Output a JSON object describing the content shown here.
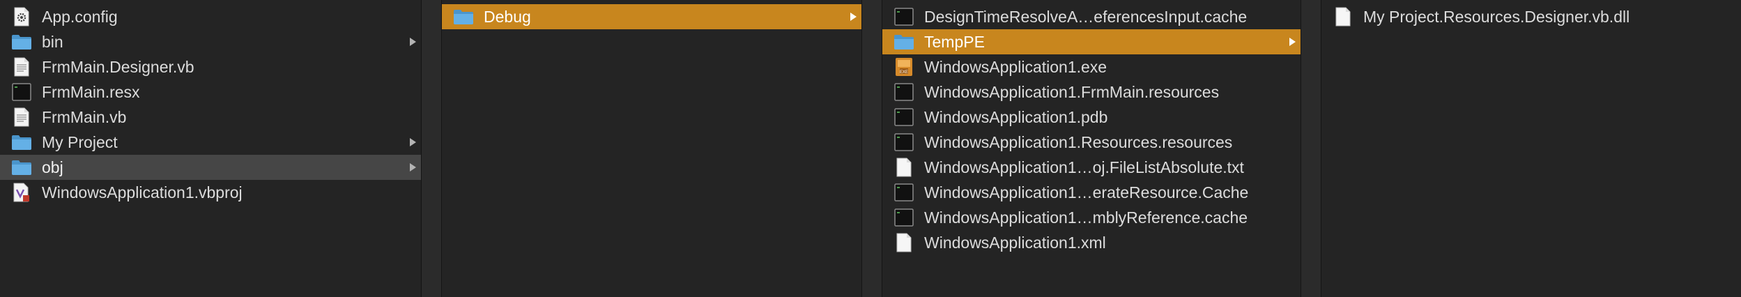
{
  "columns": [
    {
      "items": [
        {
          "name": "App.config",
          "icon": "gear-document-icon",
          "folder": false
        },
        {
          "name": "bin",
          "icon": "folder-icon",
          "folder": true
        },
        {
          "name": "FrmMain.Designer.vb",
          "icon": "text-document-icon",
          "folder": false
        },
        {
          "name": "FrmMain.resx",
          "icon": "terminal-document-icon",
          "folder": false
        },
        {
          "name": "FrmMain.vb",
          "icon": "text-document-icon",
          "folder": false
        },
        {
          "name": "My Project",
          "icon": "folder-icon",
          "folder": true
        },
        {
          "name": "obj",
          "icon": "folder-icon",
          "folder": true,
          "selected": "inactive"
        },
        {
          "name": "WindowsApplication1.vbproj",
          "icon": "visual-studio-project-icon",
          "folder": false
        }
      ]
    },
    {
      "items": [
        {
          "name": "Debug",
          "icon": "folder-icon",
          "folder": true,
          "selected": "active"
        }
      ]
    },
    {
      "items": [
        {
          "name": "DesignTimeResolveA…eferencesInput.cache",
          "icon": "terminal-document-icon",
          "folder": false
        },
        {
          "name": "TempPE",
          "icon": "folder-icon",
          "folder": true,
          "selected": "active"
        },
        {
          "name": "WindowsApplication1.exe",
          "icon": "executable-icon",
          "folder": false
        },
        {
          "name": "WindowsApplication1.FrmMain.resources",
          "icon": "terminal-document-icon",
          "folder": false
        },
        {
          "name": "WindowsApplication1.pdb",
          "icon": "terminal-document-icon",
          "folder": false
        },
        {
          "name": "WindowsApplication1.Resources.resources",
          "icon": "terminal-document-icon",
          "folder": false
        },
        {
          "name": "WindowsApplication1…oj.FileListAbsolute.txt",
          "icon": "blank-document-icon",
          "folder": false
        },
        {
          "name": "WindowsApplication1…erateResource.Cache",
          "icon": "terminal-document-icon",
          "folder": false
        },
        {
          "name": "WindowsApplication1…mblyReference.cache",
          "icon": "terminal-document-icon",
          "folder": false
        },
        {
          "name": "WindowsApplication1.xml",
          "icon": "blank-document-icon",
          "folder": false
        }
      ]
    },
    {
      "items": [
        {
          "name": "My Project.Resources.Designer.vb.dll",
          "icon": "blank-document-icon",
          "folder": false
        }
      ]
    }
  ],
  "colors": {
    "active_selection": "#c8861e",
    "inactive_selection": "#464646",
    "folder": "#5fa8dc"
  }
}
